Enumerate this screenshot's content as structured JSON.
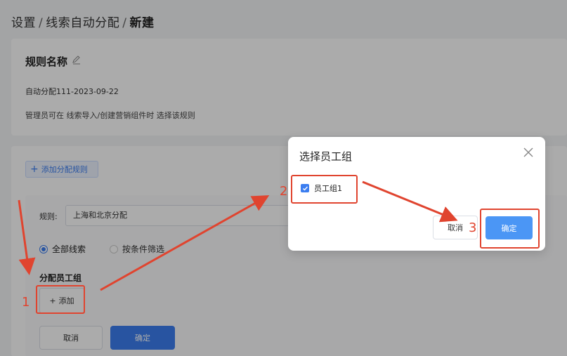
{
  "breadcrumb": {
    "items": [
      "设置",
      "线索自动分配"
    ],
    "current": "新建",
    "separator": "/"
  },
  "rule": {
    "title": "规则名称",
    "value": "自动分配111-2023-09-22",
    "description": "管理员可在 线索导入/创建营销组件时 选择该规则"
  },
  "allocation": {
    "add_rule_label": "添加分配规则",
    "rule_label": "规则:",
    "rule_value": "上海和北京分配",
    "radio_all": "全部线索",
    "radio_filter": "按条件筛选",
    "group_label": "分配员工组",
    "add_label": "添加",
    "cancel_label": "取消",
    "confirm_label": "确定"
  },
  "modal": {
    "title": "选择员工组",
    "item_label": "员工组1",
    "cancel_label": "取消",
    "confirm_label": "确定"
  },
  "annotations": {
    "step1": "1",
    "step2": "2",
    "step3": "3",
    "color": "#e0442f"
  },
  "colors": {
    "primary": "#3c7ef0",
    "modal_confirm": "#4b96f5"
  }
}
